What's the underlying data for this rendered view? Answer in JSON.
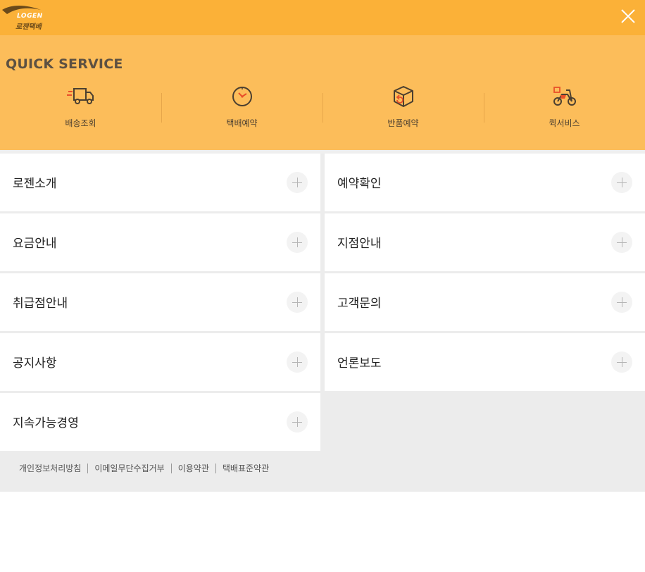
{
  "header": {
    "logo_en": "LOGEN",
    "logo_ko": "로젠택배",
    "close_icon": "close-icon",
    "color": "#fbb138"
  },
  "quick": {
    "title": "QUICK SERVICE",
    "color": "#fcbd5a",
    "items": [
      {
        "label": "배송조회",
        "icon": "truck-icon"
      },
      {
        "label": "택배예약",
        "icon": "clock-icon"
      },
      {
        "label": "반품예약",
        "icon": "return-box-icon"
      },
      {
        "label": "퀵서비스",
        "icon": "motorcycle-icon"
      }
    ]
  },
  "menu": {
    "left": [
      {
        "label": "로젠소개"
      },
      {
        "label": "요금안내"
      },
      {
        "label": "취급점안내"
      },
      {
        "label": "공지사항"
      },
      {
        "label": "지속가능경영"
      }
    ],
    "right": [
      {
        "label": "예약확인"
      },
      {
        "label": "지점안내"
      },
      {
        "label": "고객문의"
      },
      {
        "label": "언론보도"
      }
    ],
    "expand_icon": "plus-icon"
  },
  "footer": {
    "links": [
      {
        "label": "개인정보처리방침"
      },
      {
        "label": "이메일무단수집거부"
      },
      {
        "label": "이용약관"
      },
      {
        "label": "택배표준약관"
      }
    ]
  }
}
